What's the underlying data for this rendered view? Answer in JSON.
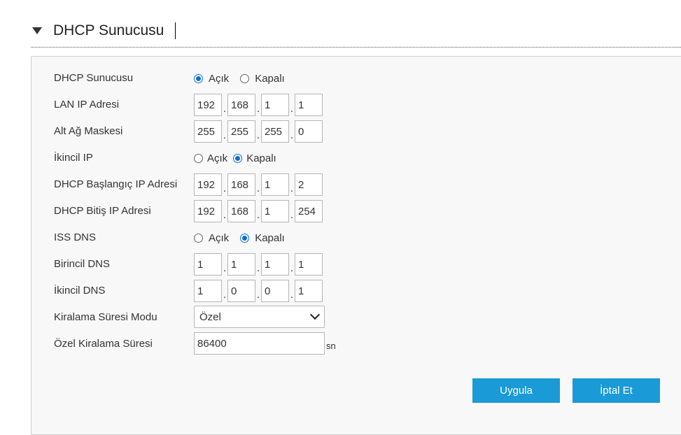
{
  "section": {
    "title": "DHCP Sunucusu"
  },
  "form": {
    "dhcp_server": {
      "label": "DHCP Sunucusu",
      "on": "Açık",
      "off": "Kapalı"
    },
    "lan_ip": {
      "label": "LAN IP Adresi",
      "octets": [
        "192",
        "168",
        "1",
        "1"
      ]
    },
    "subnet_mask": {
      "label": "Alt Ağ Maskesi",
      "octets": [
        "255",
        "255",
        "255",
        "0"
      ]
    },
    "secondary_ip": {
      "label": "İkincil IP",
      "on": "Açık",
      "off": "Kapalı"
    },
    "dhcp_start": {
      "label": "DHCP Başlangıç IP Adresi",
      "octets": [
        "192",
        "168",
        "1",
        "2"
      ]
    },
    "dhcp_end": {
      "label": "DHCP Bitiş IP Adresi",
      "octets": [
        "192",
        "168",
        "1",
        "254"
      ]
    },
    "isp_dns": {
      "label": "ISS DNS",
      "on": "Açık",
      "off": "Kapalı"
    },
    "primary_dns": {
      "label": "Birincil DNS",
      "octets": [
        "1",
        "1",
        "1",
        "1"
      ]
    },
    "secondary_dns": {
      "label": "İkincil DNS",
      "octets": [
        "1",
        "0",
        "0",
        "1"
      ]
    },
    "lease_mode": {
      "label": "Kiralama Süresi Modu",
      "value": "Özel"
    },
    "lease_time": {
      "label": "Özel Kiralama Süresi",
      "value": "86400",
      "unit": "sn"
    }
  },
  "buttons": {
    "apply": "Uygula",
    "cancel": "İptal Et"
  },
  "colors": {
    "accent": "#1a9ad6",
    "radio": "#0a6ed1"
  }
}
